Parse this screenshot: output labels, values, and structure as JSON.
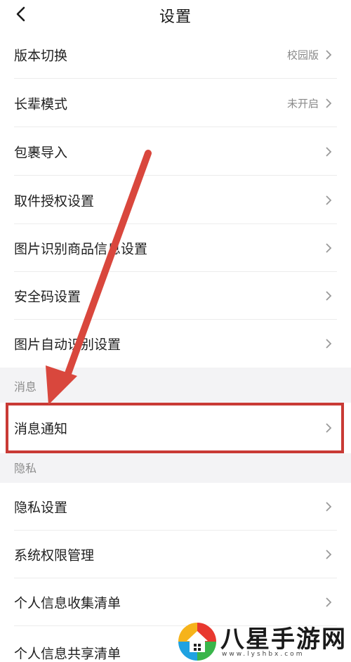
{
  "nav": {
    "title": "设置",
    "back_icon": "chevron-left-icon"
  },
  "sections": {
    "messages_label": "消息",
    "privacy_label": "隐私"
  },
  "rows": {
    "version": {
      "label": "版本切换",
      "value": "校园版"
    },
    "elder": {
      "label": "长辈模式",
      "value": "未开启"
    },
    "parcel_import": {
      "label": "包裹导入"
    },
    "pickup_auth": {
      "label": "取件授权设置"
    },
    "image_recog": {
      "label": "图片识别商品信息设置"
    },
    "security_code": {
      "label": "安全码设置"
    },
    "auto_recog": {
      "label": "图片自动识别设置"
    },
    "notification": {
      "label": "消息通知"
    },
    "privacy_settings": {
      "label": "隐私设置"
    },
    "system_perm": {
      "label": "系统权限管理"
    },
    "info_collect": {
      "label": "个人信息收集清单"
    },
    "info_share": {
      "label": "个人信息共享清单"
    }
  },
  "annotation": {
    "color": "#c93a35"
  },
  "watermark": {
    "brand": "八星手游网",
    "url": "www.lyshbx.com"
  }
}
